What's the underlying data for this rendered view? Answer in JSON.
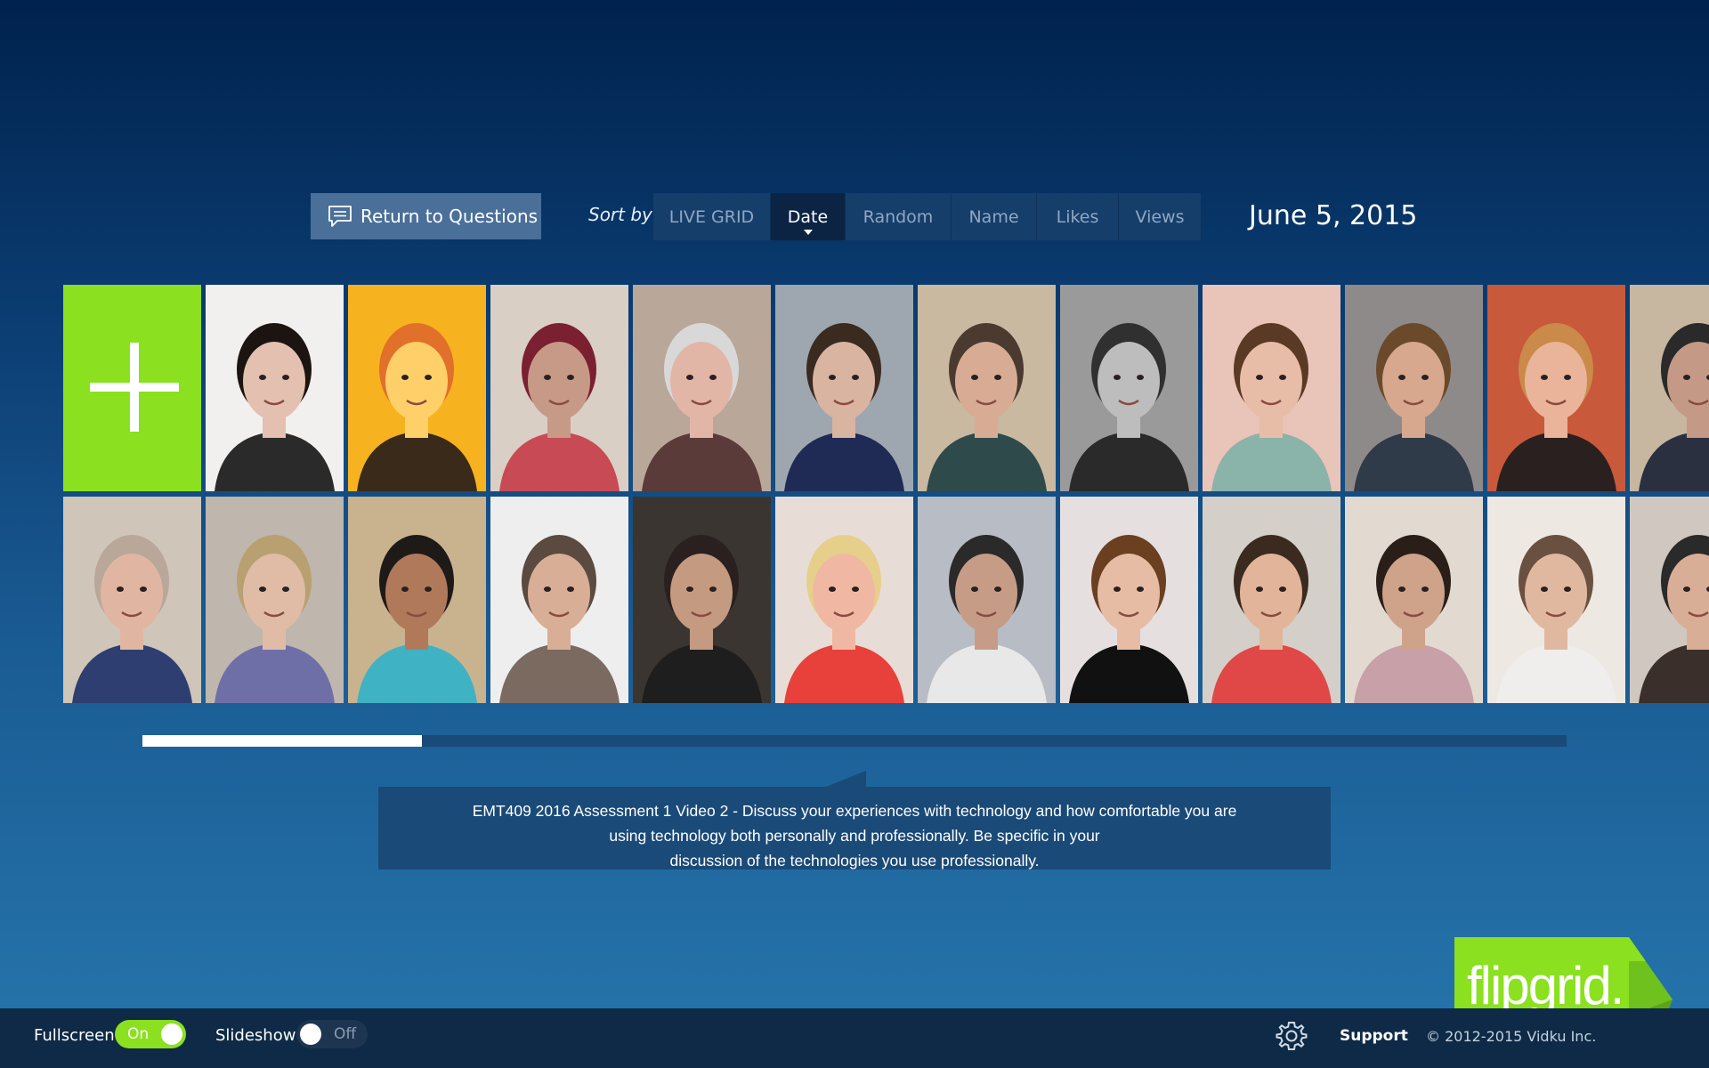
{
  "toolbar": {
    "return_label": "Return to Questions",
    "return_icon": "speech-bubble-icon",
    "sort_label": "Sort by",
    "sort_tabs": [
      {
        "label": "LIVE GRID",
        "active": false
      },
      {
        "label": "Date",
        "active": true
      },
      {
        "label": "Random",
        "active": false
      },
      {
        "label": "Name",
        "active": false
      },
      {
        "label": "Likes",
        "active": false
      },
      {
        "label": "Views",
        "active": false
      }
    ],
    "current_date": "June 5, 2015"
  },
  "grid": {
    "add_tile_icon": "plus-icon",
    "add_tile_color": "#8be01f",
    "videos_row1": 11,
    "videos_row2": 12
  },
  "scroll": {
    "position_fraction": 0.196
  },
  "question": {
    "line1": "EMT409 2016 Assessment 1 Video 2 - Discuss your experiences with technology and how comfortable you are",
    "line2": "using technology both personally and professionally. Be specific in your",
    "line3": "discussion of the technologies you use professionally."
  },
  "footer": {
    "fullscreen_label": "Fullscreen",
    "fullscreen_state": "On",
    "slideshow_label": "Slideshow",
    "slideshow_state": "Off",
    "settings_icon": "gear-icon",
    "support_label": "Support",
    "copyright": "© 2012-2015 Vidku Inc."
  },
  "logo": {
    "text": "flipgrid."
  },
  "colors": {
    "accent_green": "#8be01f",
    "panel": "#1a4a78",
    "footer": "#0e2a46"
  }
}
